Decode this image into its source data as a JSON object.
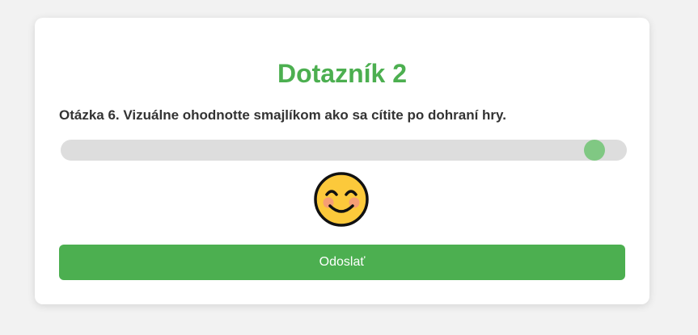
{
  "form": {
    "title": "Dotazník 2",
    "question": "Otázka 6. Vizuálne ohodnotte smajlíkom ako sa cítite po dohraní hry.",
    "slider": {
      "value_fraction": 0.96
    },
    "emoji_icon": "smiling-face-with-smiling-eyes-icon",
    "submit_label": "Odoslať"
  },
  "colors": {
    "accent": "#4caf50",
    "slider_thumb": "#80c883",
    "slider_track": "#dddddd",
    "emoji_face": "#fcc93b",
    "background": "#f2f2f2"
  }
}
